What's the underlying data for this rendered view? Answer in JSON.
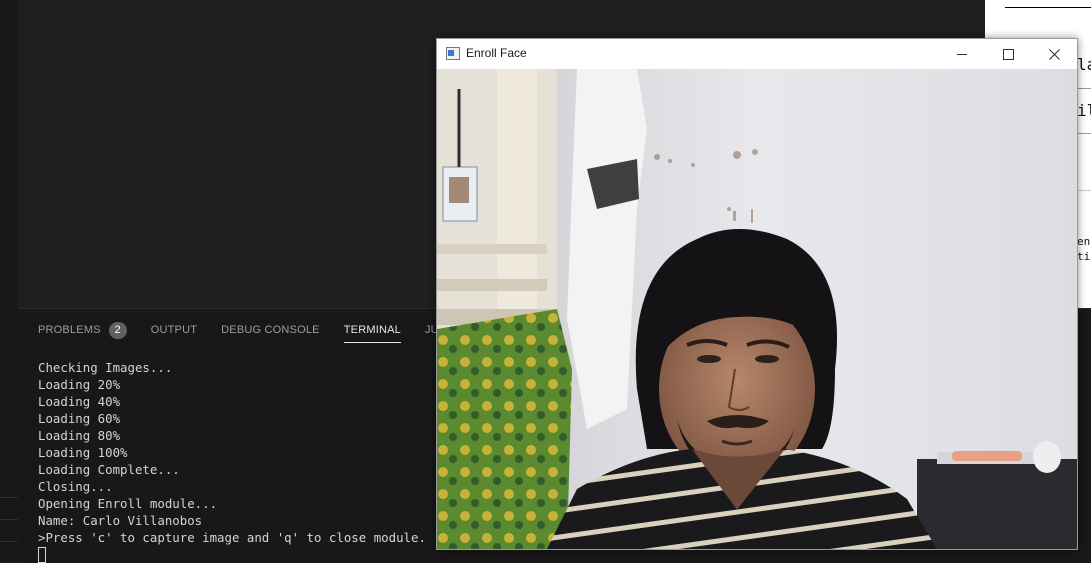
{
  "panel": {
    "tabs": [
      {
        "label": "PROBLEMS",
        "badge": "2"
      },
      {
        "label": "OUTPUT"
      },
      {
        "label": "DEBUG CONSOLE"
      },
      {
        "label": "TERMINAL"
      },
      {
        "label": "JUPYTER"
      }
    ],
    "active_tab": "TERMINAL"
  },
  "terminal": {
    "lines": [
      "Checking Images...",
      "Loading 20%",
      "Loading 40%",
      "Loading 60%",
      "Loading 80%",
      "Loading 100%",
      "Loading Complete...",
      "Closing...",
      "Opening Enroll module...",
      "Name: Carlo Villanobos",
      ">Press 'c' to capture image and 'q' to close module."
    ]
  },
  "window": {
    "title": "Enroll Face",
    "icon": "app-window-icon",
    "controls": [
      "minimize-icon",
      "maximize-icon",
      "close-icon"
    ]
  },
  "background_doc": {
    "fragments": [
      "lar",
      "il",
      "en",
      "ti"
    ]
  }
}
